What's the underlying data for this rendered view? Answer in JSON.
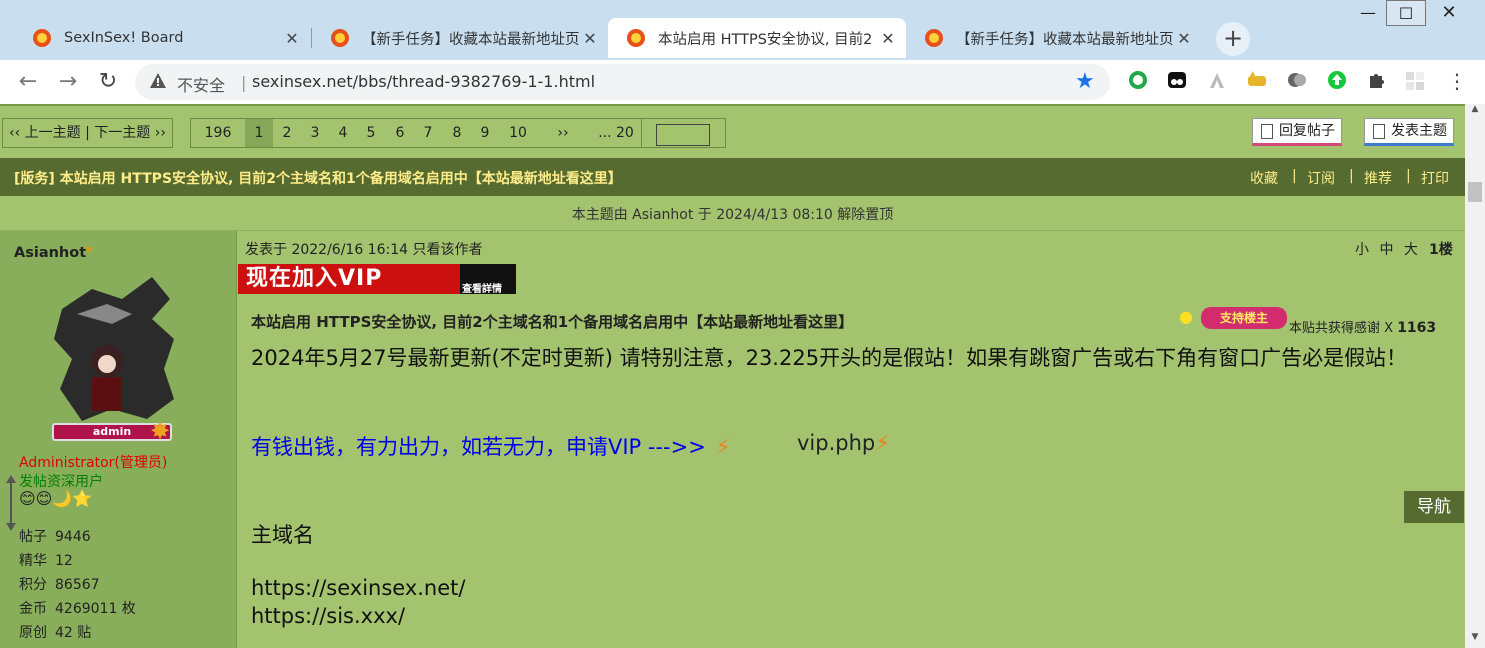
{
  "browser": {
    "tabs": [
      {
        "title": "SexInSex! Board",
        "active": false
      },
      {
        "title": "【新手任务】收藏本站最新地址页",
        "active": false
      },
      {
        "title": "本站启用 HTTPS安全协议, 目前2",
        "active": true
      },
      {
        "title": "【新手任务】收藏本站最新地址页",
        "active": false
      }
    ],
    "new_tab": "+",
    "window_controls": {
      "minimize": "—",
      "maximize": "☐",
      "close": "✕"
    },
    "nav": {
      "back": "←",
      "forward": "→",
      "reload": "↻"
    },
    "omnibox": {
      "security": "不安全",
      "separator": "|",
      "url": "sexinsex.net/bbs/thread-9382769-1-1.html",
      "star": "★"
    },
    "menu": "⋮"
  },
  "forum": {
    "prev_next": "‹‹ 上一主题 | 下一主题 ››",
    "pager": {
      "total": "196",
      "pages": [
        "1",
        "2",
        "3",
        "4",
        "5",
        "6",
        "7",
        "8",
        "9",
        "10"
      ],
      "current": "1",
      "next": "››",
      "last": "... 20"
    },
    "reply_button": "回复帖子",
    "new_topic_button": "发表主题",
    "thread_title": "[版务] 本站启用 HTTPS安全协议, 目前2个主域名和1个备用域名启用中【本站最新地址看这里】",
    "header_links": [
      "收藏",
      "订阅",
      "推荐",
      "打印"
    ],
    "header_sep": "|",
    "notice": "本主题由 Asianhot 于 2024/4/13 08:10 解除置顶"
  },
  "author": {
    "name": "Asianhot",
    "badge": "admin",
    "role": "Administrator(管理员)",
    "group": "发帖资深用户",
    "medals": "😊😊🌙⭐",
    "stats": [
      {
        "label": "帖子",
        "value": "9446"
      },
      {
        "label": "精华",
        "value": "12"
      },
      {
        "label": "积分",
        "value": "86567"
      },
      {
        "label": "金币",
        "value": "4269011 枚"
      },
      {
        "label": "原创",
        "value": "42 贴"
      }
    ]
  },
  "post": {
    "meta": "发表于 2022/6/16 16:14  只看该作者",
    "font_sizes": "小 中 大",
    "floor": "1楼",
    "vip_banner": "现在加入VIP",
    "vip_banner_sub": "查看詳情",
    "title": "本站启用 HTTPS安全协议, 目前2个主域名和1个备用域名启用中【本站最新地址看这里】",
    "support_badge": "支持楼主",
    "thanks_label": "本贴共获得感谢 X",
    "thanks_count": "1163",
    "body_paragraph": "2024年5月27号最新更新(不定时更新) 请特别注意，23.225开头的是假站！如果有跳窗广告或右下角有窗口广告必是假站！",
    "vip_line": "有钱出钱，有力出力，如若无力，申请VIP --->>",
    "vip_link": "vip.php",
    "domain_heading": "主域名",
    "domains": [
      "https://sexinsex.net/",
      "https://sis.xxx/"
    ],
    "nav_button": "导航"
  },
  "colors": {
    "forum_bg": "#a3c36f",
    "header_bg": "#556b2f",
    "header_text": "#ffec8b",
    "role_red": "#e00000",
    "group_green": "#008000",
    "link_blue": "#0000ee"
  }
}
